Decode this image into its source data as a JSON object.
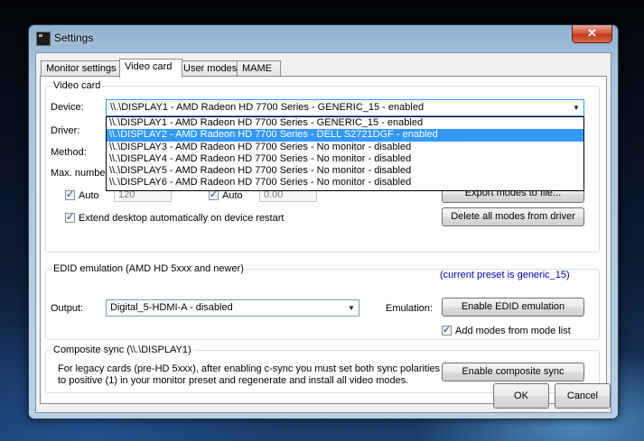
{
  "window": {
    "title": "Settings",
    "close_glyph": "✕"
  },
  "tabs": [
    {
      "label": "Monitor settings"
    },
    {
      "label": "Video card"
    },
    {
      "label": "User modes"
    },
    {
      "label": "MAME"
    }
  ],
  "video_card": {
    "group_title": "Video card",
    "device_label": "Device:",
    "device_value": "\\\\.\\DISPLAY1 - AMD Radeon HD 7700 Series - GENERIC_15 - enabled",
    "driver_label": "Driver:",
    "method_label": "Method:",
    "maxnum_label": "Max. numbe",
    "auto1_label": "Auto",
    "auto1_value": "120",
    "auto2_label": "Auto",
    "auto2_value": "0.00",
    "extend_label": "Extend desktop automatically on device restart",
    "export_button": "Export modes to file...",
    "delete_button": "Delete all modes from driver",
    "device_options": [
      "\\\\.\\DISPLAY1 - AMD Radeon HD 7700 Series - GENERIC_15 - enabled",
      "\\\\.\\DISPLAY2 - AMD Radeon HD 7700 Series - DELL S2721DGF - enabled",
      "\\\\.\\DISPLAY3 - AMD Radeon HD 7700 Series - No monitor - disabled",
      "\\\\.\\DISPLAY4 - AMD Radeon HD 7700 Series - No monitor - disabled",
      "\\\\.\\DISPLAY5 - AMD Radeon HD 7700 Series - No monitor - disabled",
      "\\\\.\\DISPLAY6 - AMD Radeon HD 7700 Series - No monitor - disabled"
    ]
  },
  "edid": {
    "group_title": "EDID emulation (AMD HD 5xxx and newer)",
    "preset_note": "(current preset is generic_15)",
    "output_label": "Output:",
    "output_value": "Digital_5-HDMI-A - disabled",
    "emulation_label": "Emulation:",
    "enable_button": "Enable EDID emulation",
    "add_modes_label": "Add modes from mode list"
  },
  "csync": {
    "group_title": "Composite sync (\\\\.\\DISPLAY1)",
    "line1": "For legacy cards (pre-HD 5xxx), after enabling c-sync you must set both sync polarities",
    "line2": "to positive (1) in your monitor preset and regenerate and install all video modes.",
    "enable_button": "Enable composite sync"
  },
  "footer": {
    "ok": "OK",
    "cancel": "Cancel"
  },
  "colors": {
    "accent": "#3399ff",
    "link_blue": "#0000cc"
  }
}
